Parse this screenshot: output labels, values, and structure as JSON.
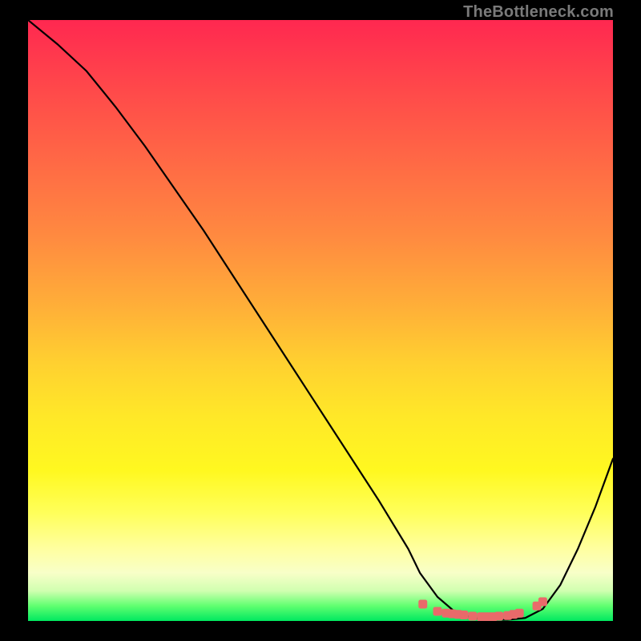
{
  "watermark": "TheBottleneck.com",
  "chart_data": {
    "type": "line",
    "title": "",
    "xlabel": "",
    "ylabel": "",
    "xlim": [
      0,
      100
    ],
    "ylim": [
      0,
      100
    ],
    "grid": false,
    "legend": false,
    "series": [
      {
        "name": "curve",
        "x": [
          0,
          5,
          10,
          15,
          20,
          25,
          30,
          35,
          40,
          45,
          50,
          55,
          60,
          65,
          67,
          70,
          73,
          76,
          79,
          82,
          85,
          88,
          91,
          94,
          97,
          100
        ],
        "y": [
          100,
          96,
          91.5,
          85.5,
          79,
          72,
          65,
          57.5,
          50,
          42.5,
          35,
          27.5,
          20,
          12,
          8,
          4,
          1.5,
          0.5,
          0.2,
          0.2,
          0.5,
          2,
          6,
          12,
          19,
          27
        ],
        "stroke": "#000000",
        "stroke_width": 2
      },
      {
        "name": "bottom-markers",
        "x": [
          67.5,
          70,
          71.5,
          72.5,
          73.5,
          74.5,
          76,
          77.5,
          78.5,
          79.5,
          80.5,
          82,
          83,
          84,
          87,
          88
        ],
        "y": [
          2.8,
          1.6,
          1.3,
          1.2,
          1.1,
          1.0,
          0.8,
          0.7,
          0.7,
          0.7,
          0.8,
          0.9,
          1.1,
          1.3,
          2.5,
          3.2
        ],
        "marker": "square",
        "color": "#e96a6a"
      }
    ],
    "background_gradient": {
      "type": "vertical",
      "stops": [
        {
          "pos": 0.0,
          "color": "#ff2850"
        },
        {
          "pos": 0.12,
          "color": "#ff4a4a"
        },
        {
          "pos": 0.24,
          "color": "#ff6a45"
        },
        {
          "pos": 0.36,
          "color": "#ff8a40"
        },
        {
          "pos": 0.48,
          "color": "#ffb038"
        },
        {
          "pos": 0.57,
          "color": "#ffd030"
        },
        {
          "pos": 0.66,
          "color": "#ffe828"
        },
        {
          "pos": 0.75,
          "color": "#fff820"
        },
        {
          "pos": 0.82,
          "color": "#ffff5a"
        },
        {
          "pos": 0.88,
          "color": "#ffffa0"
        },
        {
          "pos": 0.92,
          "color": "#f8ffc8"
        },
        {
          "pos": 0.95,
          "color": "#d0ffb0"
        },
        {
          "pos": 0.975,
          "color": "#60ff70"
        },
        {
          "pos": 1.0,
          "color": "#00e860"
        }
      ]
    }
  }
}
